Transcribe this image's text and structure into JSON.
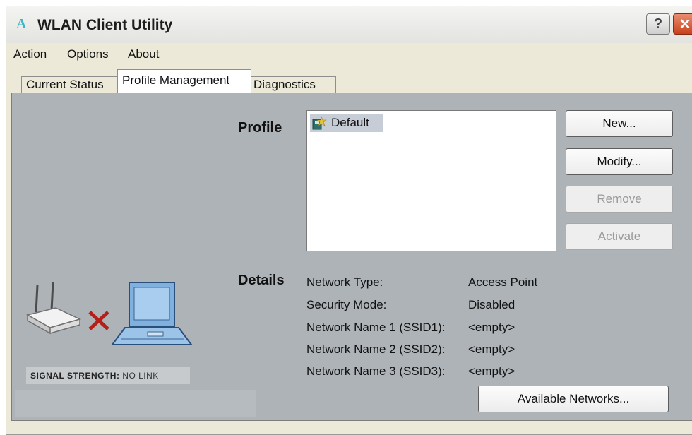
{
  "window": {
    "title": "WLAN Client Utility",
    "logo_glyph": "A",
    "help_glyph": "?",
    "close_glyph": "✕"
  },
  "menu": {
    "items": [
      "Action",
      "Options",
      "About"
    ]
  },
  "tabs": [
    {
      "label": "Current Status",
      "active": false
    },
    {
      "label": "Profile Management",
      "active": true
    },
    {
      "label": "Diagnostics",
      "active": false
    }
  ],
  "profile": {
    "section_label": "Profile",
    "entries": [
      {
        "name": "Default",
        "icon": "profile-icon",
        "selected": true
      }
    ]
  },
  "buttons": {
    "new": "New...",
    "modify": "Modify...",
    "remove": "Remove",
    "activate": "Activate",
    "available_networks": "Available Networks..."
  },
  "details": {
    "section_label": "Details",
    "rows": [
      {
        "label": "Network Type:",
        "value": "Access Point"
      },
      {
        "label": "Security Mode:",
        "value": "Disabled"
      },
      {
        "label": "Network Name 1 (SSID1):",
        "value": "<empty>"
      },
      {
        "label": "Network Name 2 (SSID2):",
        "value": "<empty>"
      },
      {
        "label": "Network Name 3 (SSID3):",
        "value": "<empty>"
      }
    ]
  },
  "signal": {
    "label": "SIGNAL STRENGTH:",
    "value": "NO LINK"
  },
  "colors": {
    "panel": "#aeb3b8",
    "link_error": "#b3201a",
    "close": "#c8421c",
    "logo": "#3bb6c9"
  }
}
